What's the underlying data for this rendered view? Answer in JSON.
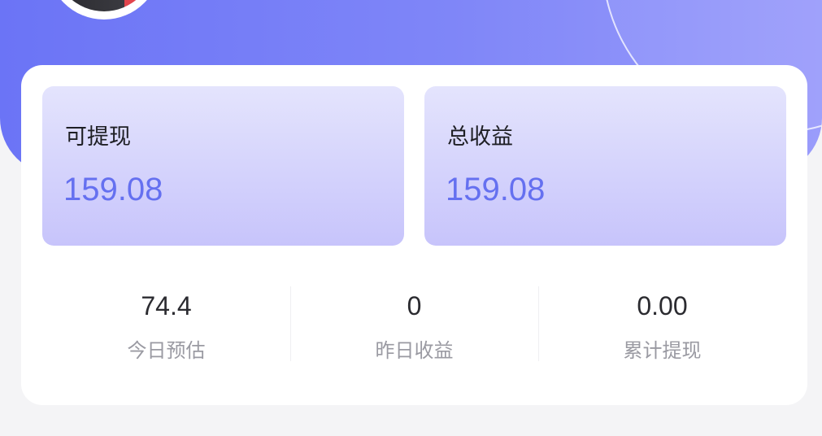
{
  "balance_cards": [
    {
      "label": "可提现",
      "value": "159.08"
    },
    {
      "label": "总收益",
      "value": "159.08"
    }
  ],
  "metrics": [
    {
      "value": "74.4",
      "label": "今日预估"
    },
    {
      "value": "0",
      "label": "昨日收益"
    },
    {
      "value": "0.00",
      "label": "累计提现"
    }
  ],
  "colors": {
    "header_gradient_start": "#6b74f6",
    "header_gradient_end": "#9a9cfb",
    "accent": "#6570f0",
    "card_gradient_top": "#e4e4fd",
    "card_gradient_bottom": "#c7c4fb"
  },
  "icons": {
    "avatar": "user-avatar-image"
  }
}
